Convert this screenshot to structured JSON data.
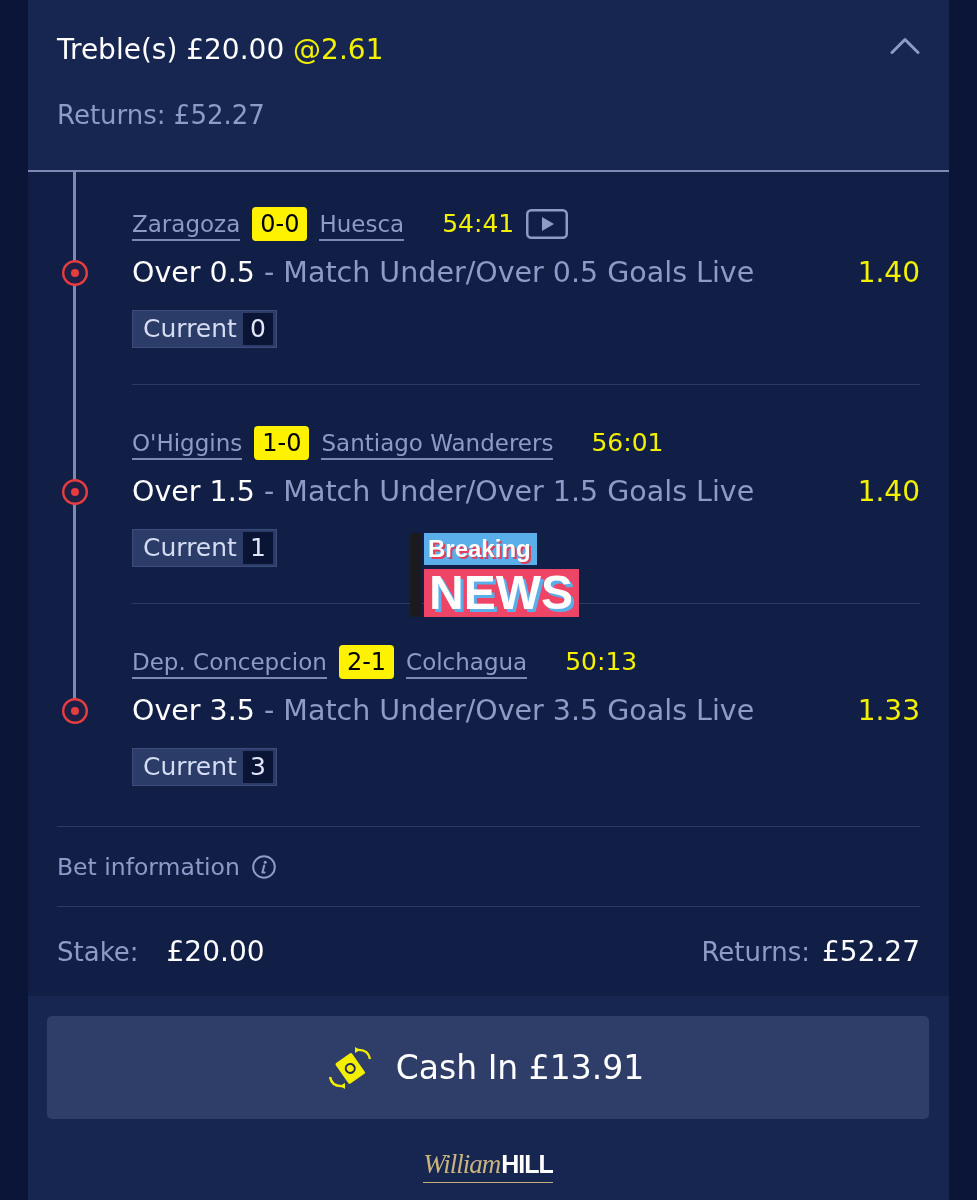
{
  "bet": {
    "title": "Treble(s) £20.00",
    "odds": "@2.61",
    "returns": "Returns: £52.27",
    "expanded": true
  },
  "legs": [
    {
      "home": "Zaragoza",
      "score": "0-0",
      "away": "Huesca",
      "clock": "54:41",
      "stream": true,
      "selection": "Over 0.5",
      "market": "- Match Under/Over 0.5 Goals Live",
      "price": "1.40",
      "current_label": "Current",
      "current_value": "0"
    },
    {
      "home": "O'Higgins",
      "score": "1-0",
      "away": "Santiago Wanderers",
      "clock": "56:01",
      "stream": false,
      "selection": "Over 1.5",
      "market": "- Match Under/Over 1.5 Goals Live",
      "price": "1.40",
      "current_label": "Current",
      "current_value": "1"
    },
    {
      "home": "Dep. Concepcion",
      "score": "2-1",
      "away": "Colchagua",
      "clock": "50:13",
      "stream": false,
      "selection": "Over 3.5",
      "market": "- Match Under/Over 3.5 Goals Live",
      "price": "1.33",
      "current_label": "Current",
      "current_value": "3"
    }
  ],
  "sticker": {
    "top": "Breaking",
    "bottom": "NEWS"
  },
  "bet_information": "Bet information",
  "stake": {
    "label": "Stake:",
    "value": "£20.00"
  },
  "returns": {
    "label": "Returns:",
    "value": "£52.27"
  },
  "cash_in_button": "Cash In £13.91",
  "logo": {
    "script": "William",
    "bold": "HILL"
  }
}
